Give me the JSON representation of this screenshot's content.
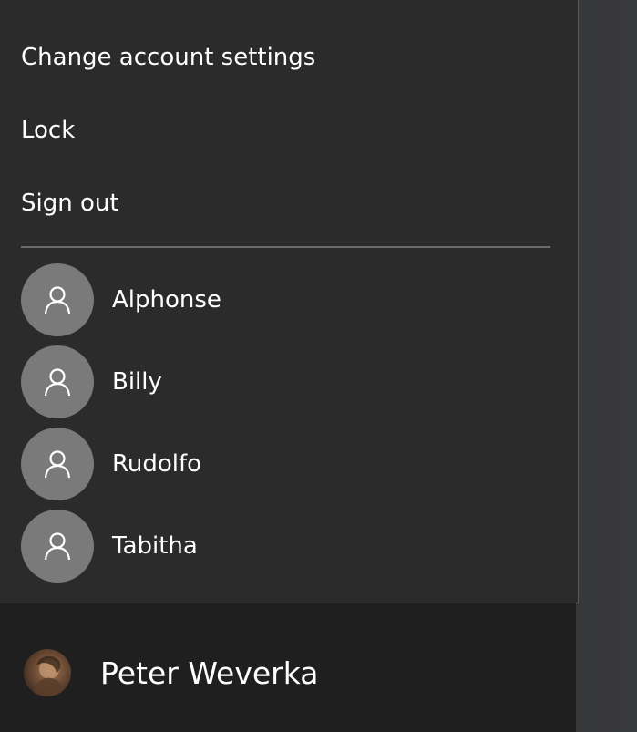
{
  "menu": {
    "items": [
      {
        "label": "Change account settings"
      },
      {
        "label": "Lock"
      },
      {
        "label": "Sign out"
      }
    ]
  },
  "other_users": [
    {
      "name": "Alphonse"
    },
    {
      "name": "Billy"
    },
    {
      "name": "Rudolfo"
    },
    {
      "name": "Tabitha"
    }
  ],
  "current_user": {
    "name": "Peter Weverka"
  },
  "colors": {
    "flyout_bg": "#2b2b2b",
    "avatar_bg": "#7a7a7a",
    "text": "#ffffff",
    "divider": "#6a6a6a"
  },
  "icons": {
    "user_placeholder": "person-icon"
  }
}
